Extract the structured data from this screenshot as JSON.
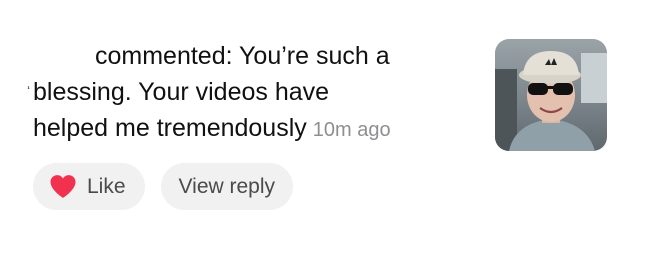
{
  "comment": {
    "line1": "commented: You’re such a",
    "line2": "blessing. Your videos have",
    "line3": "helped me tremendously",
    "clipped_glyph": "ʻ",
    "timestamp": "10m ago"
  },
  "thumbnail": {
    "icon": "person-photo",
    "description_icon": "commenter-avatar"
  },
  "actions": {
    "like_label": "Like",
    "like_icon": "heart-icon",
    "like_color": "#f0324f",
    "reply_label": "View reply"
  },
  "colors": {
    "pill_bg": "#f1f1f2",
    "text": "#111111",
    "muted": "#8e8e93"
  }
}
